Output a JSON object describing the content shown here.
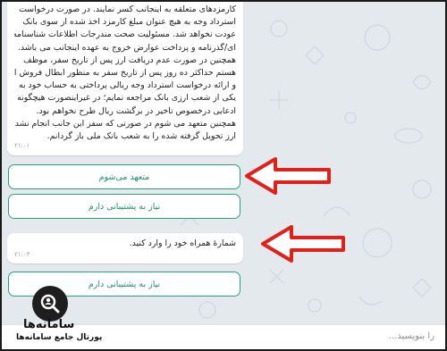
{
  "chat": {
    "message1": {
      "lines": [
        "کارمزدهای متعلقه به اینجانب کسر نمایند. در صورت درخواست",
        "استرداد وجه به هیچ عنوان مبلغ کارمزد اخذ شده از سوی بانک",
        "عودت نخواهد شد. مسئولیت صحت مندرجات اطلاعات شناسنامه",
        "ای/گذرنامه و پرداخت عوارض خروج به عهده اینجانب می باشد.",
        "همچنین در صورت عدم دریافت ارز پس از تاریخ سفر، موظف",
        "هستم حداکثر ده روز پس از تاریخ سفر به منظور ابطال فروش ارز",
        "و ارائه درخواست استرداد وجه ریالی پرداختی به حساب خود به",
        "یکی از شعب ارزی بانک مراجعه نمایم؛ در غیراینصورت هیچگونه",
        "ادعایی درخصوص تاخیر در برگشت ریال طرح نخواهم بود.",
        "همچنین متعهد می شوم در صورتی که سفر این جانب انجام نشد",
        "ارز تحویل گرفته شده را به شعب بانک ملی باز گردانم."
      ],
      "time": "۲۱:۰۱"
    },
    "button_commit": "متعهد می‌شوم",
    "button_support_1": "نیاز به پشتیبانی دارم",
    "message2": {
      "text": "شمارهٔ همراه خود را وارد کنید.",
      "time": "۲۱:۰۳"
    },
    "button_support_2": "نیاز به پشتیبانی دارم"
  },
  "input": {
    "placeholder": "را بنویسید..."
  },
  "watermark": {
    "brand": "سامانه‌ها",
    "tagline": "پورتال جامع سامانه‌ها"
  },
  "colors": {
    "accent": "#2aa37a",
    "arrow": "#e0201b",
    "background": "#e4e9ee"
  }
}
